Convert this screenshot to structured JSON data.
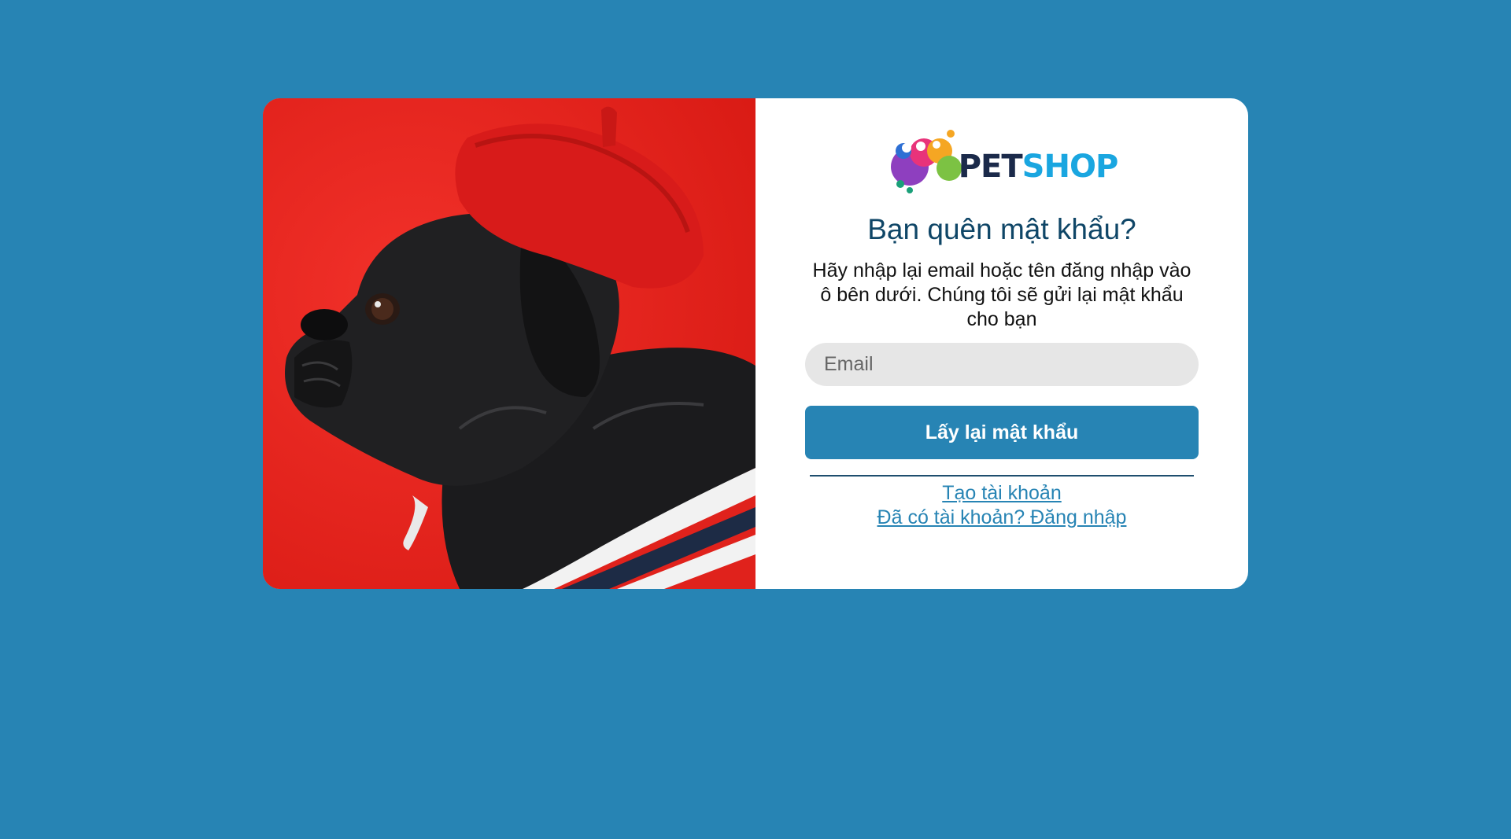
{
  "brand": {
    "logo_pet": "PET",
    "logo_shop": "SHOP"
  },
  "form": {
    "title": "Bạn quên mật khẩu?",
    "description": "Hãy nhập lại email hoặc tên đăng nhập vào ô bên dưới. Chúng tôi sẽ gửi lại mật khẩu cho bạn",
    "email_placeholder": "Email",
    "email_value": "",
    "submit_label": "Lấy lại mật khẩu"
  },
  "links": {
    "create_account": "Tạo tài khoản",
    "login": "Đã có tài khoản? Đăng nhập"
  },
  "colors": {
    "background": "#2784b4",
    "card": "#ffffff",
    "accent": "#2784b4",
    "title": "#0f4667",
    "photo_red": "#e8201e"
  }
}
